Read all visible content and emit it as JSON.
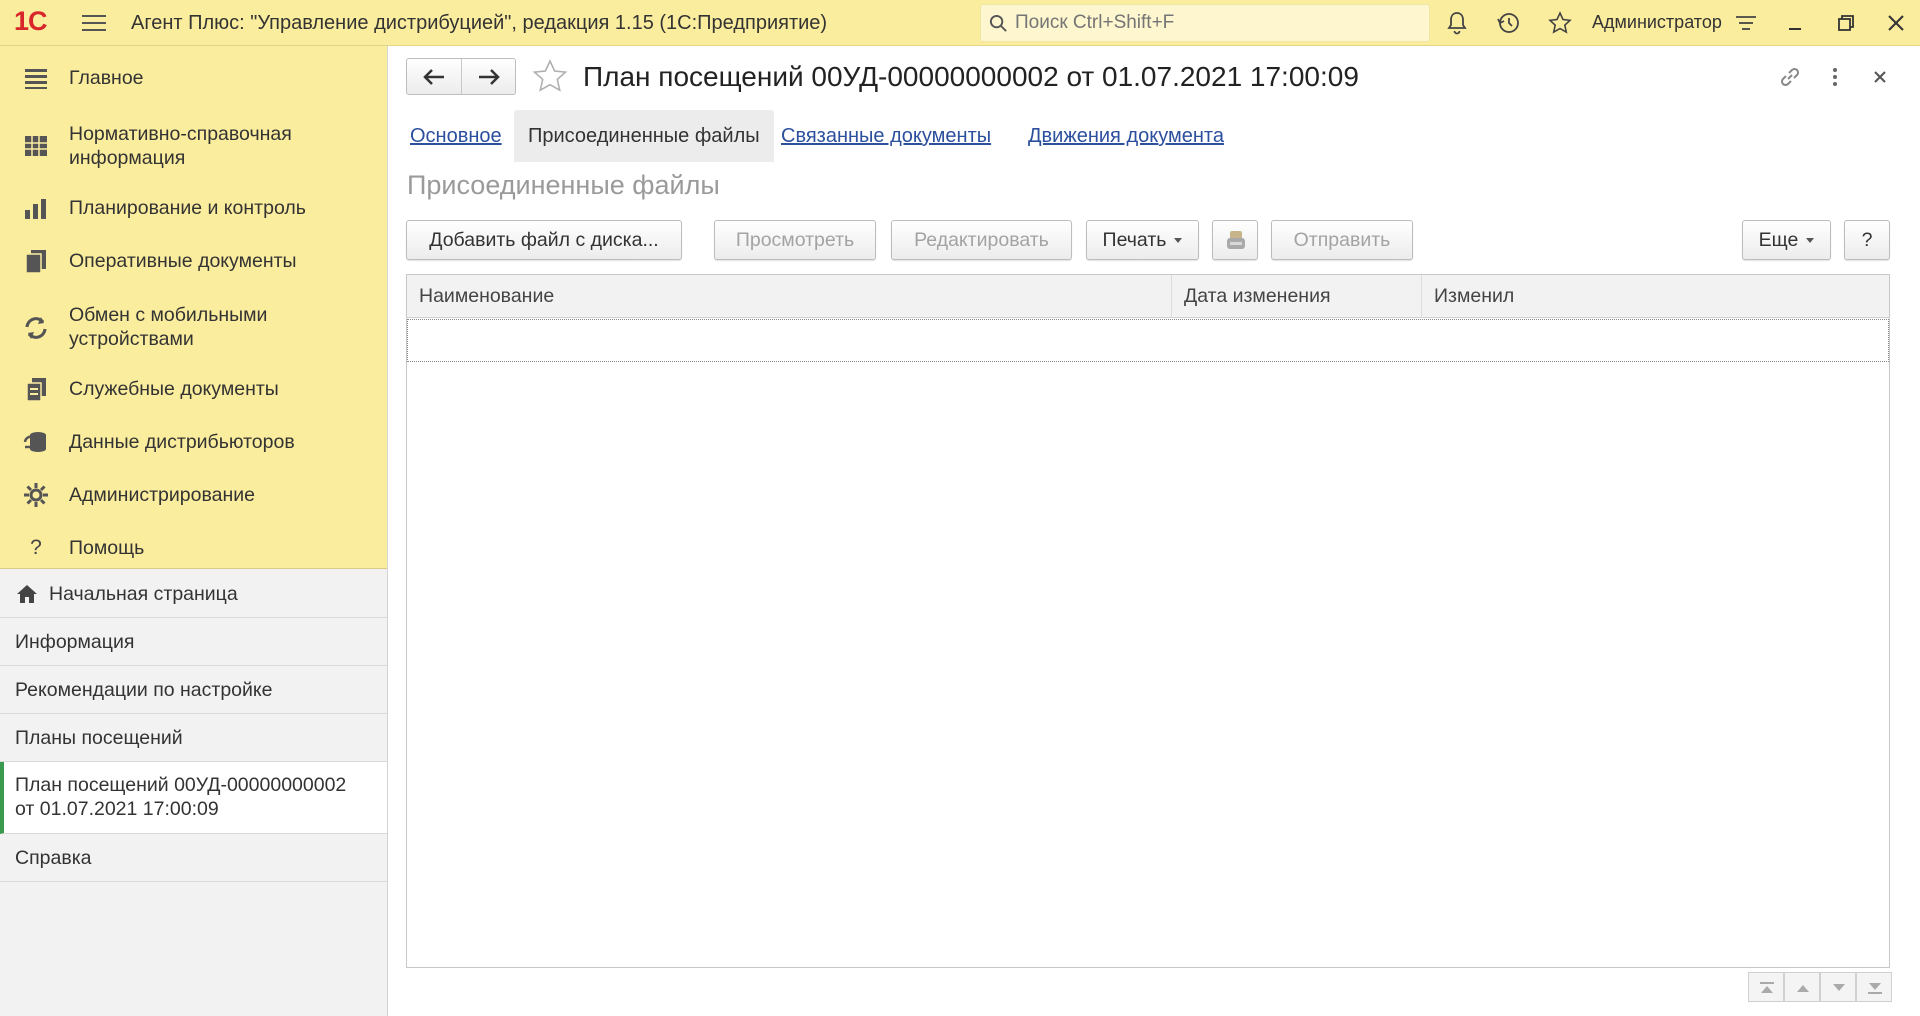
{
  "app": {
    "logo_text": "1С",
    "window_title": "Агент Плюс: \"Управление дистрибуцией\", редакция 1.15  (1С:Предприятие)",
    "search_placeholder": "Поиск Ctrl+Shift+F",
    "user": "Администратор"
  },
  "colors": {
    "titlebar_bg": "#fbed9e",
    "section_panel_bg": "#fbed9e",
    "link": "#2c4f9e",
    "logo_red": "#d8262b",
    "active_marker": "#3a9a4f"
  },
  "sections": [
    {
      "label": "Главное",
      "icon": "list-lines-icon"
    },
    {
      "label": "Нормативно-справочная информация",
      "icon": "grid-reference-icon"
    },
    {
      "label": "Планирование и контроль",
      "icon": "bar-chart-icon"
    },
    {
      "label": "Оперативные документы",
      "icon": "documents-icon"
    },
    {
      "label": "Обмен с мобильными устройствами",
      "icon": "sync-arrows-icon"
    },
    {
      "label": "Служебные документы",
      "icon": "service-documents-icon"
    },
    {
      "label": "Данные дистрибьюторов",
      "icon": "distributor-data-icon"
    },
    {
      "label": "Администрирование",
      "icon": "gear-icon"
    },
    {
      "label": "Помощь",
      "icon": "question-icon"
    }
  ],
  "open_windows": [
    {
      "label": "Начальная страница",
      "icon": "home-icon"
    },
    {
      "label": "Информация"
    },
    {
      "label": "Рекомендации по настройке"
    },
    {
      "label": "Планы посещений"
    },
    {
      "label_line1": "План посещений 00УД-00000000002",
      "label_line2": "от 01.07.2021 17:00:09",
      "active": true
    },
    {
      "label": "Справка"
    }
  ],
  "document": {
    "title": "План посещений 00УД-00000000002 от 01.07.2021 17:00:09",
    "tabs": [
      {
        "label": "Основное"
      },
      {
        "label": "Присоединенные файлы",
        "active": true
      },
      {
        "label": "Связанные документы"
      },
      {
        "label": "Движения документа"
      }
    ],
    "caption": "Присоединенные файлы"
  },
  "toolbar": {
    "add_file": "Добавить файл с диска...",
    "view": "Просмотреть",
    "edit": "Редактировать",
    "print": "Печать",
    "send": "Отправить",
    "more": "Еще",
    "help": "?"
  },
  "table": {
    "columns": [
      "Наименование",
      "Дата изменения",
      "Изменил"
    ],
    "rows": []
  }
}
